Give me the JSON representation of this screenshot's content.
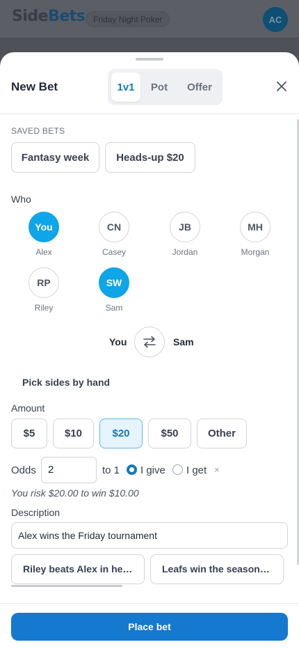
{
  "app": {
    "logo_part1": "Side",
    "logo_part2": "Bets",
    "group": "Friday Night Poker",
    "user_initials": "AC"
  },
  "sheet": {
    "title": "New Bet",
    "tabs": [
      {
        "label": "1v1",
        "active": true
      },
      {
        "label": "Pot",
        "active": false
      },
      {
        "label": "Offer",
        "active": false
      }
    ]
  },
  "saved_bets": {
    "label": "SAVED BETS",
    "items": [
      "Fantasy week",
      "Heads-up $20"
    ]
  },
  "who": {
    "label": "Who",
    "people": [
      {
        "initials": "You",
        "name": "Alex",
        "selected": true
      },
      {
        "initials": "CN",
        "name": "Casey",
        "selected": false
      },
      {
        "initials": "JB",
        "name": "Jordan",
        "selected": false
      },
      {
        "initials": "MH",
        "name": "Morgan",
        "selected": false
      },
      {
        "initials": "RP",
        "name": "Riley",
        "selected": false
      },
      {
        "initials": "SW",
        "name": "Sam",
        "selected": true
      }
    ]
  },
  "matchup": {
    "left": "You",
    "right": "Sam"
  },
  "pick_sides": "Pick sides by hand",
  "amount": {
    "label": "Amount",
    "options": [
      "$5",
      "$10",
      "$20",
      "$50",
      "Other"
    ],
    "selected": "$20"
  },
  "odds": {
    "label": "Odds",
    "value": "2",
    "to_label": "to 1",
    "give_label": "I give",
    "get_label": "I get",
    "selected": "give",
    "clear": "×"
  },
  "risk_text": "You risk $20.00 to win $10.00",
  "description": {
    "label": "Description",
    "value": "Alex wins the Friday tournament",
    "suggestions": [
      "Riley beats Alex in he…",
      "Leafs win the season …"
    ]
  },
  "place_bet": "Place bet",
  "colors": {
    "accent": "#1479cf",
    "selected_circle": "#0ea5e9"
  }
}
